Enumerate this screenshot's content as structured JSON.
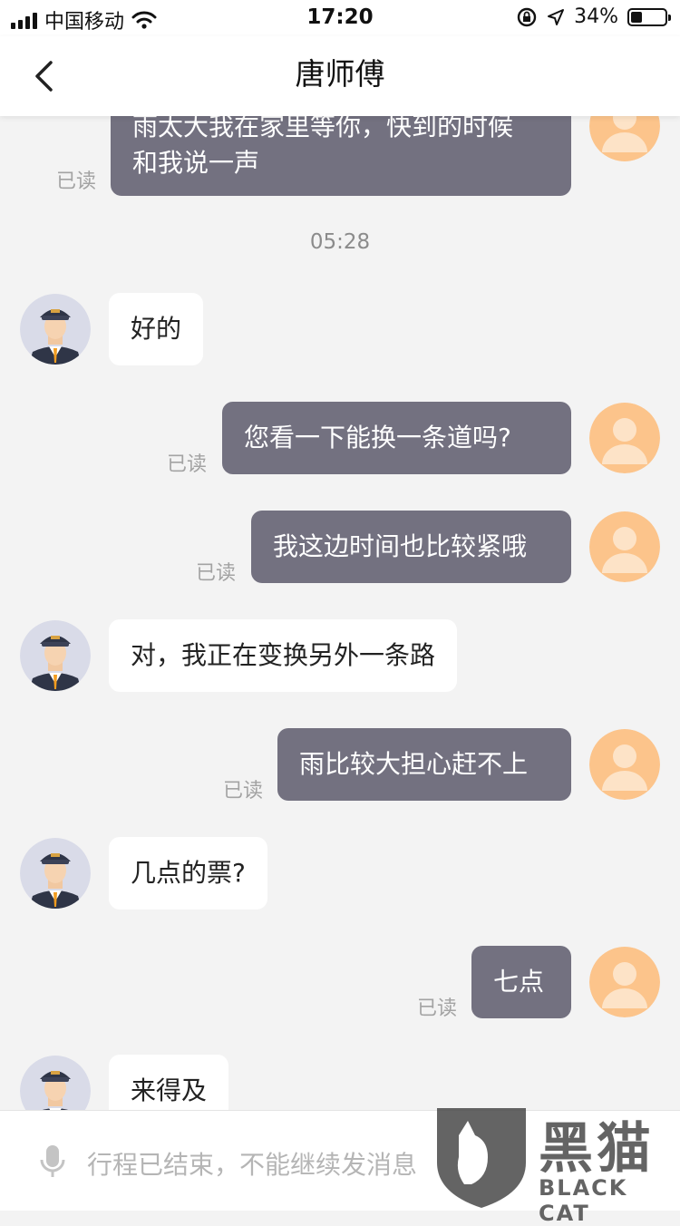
{
  "status_bar": {
    "carrier": "中国移动",
    "time": "17:20",
    "battery_percent_text": "34%",
    "battery_level": 0.34,
    "icons": [
      "signal-icon",
      "wifi-icon",
      "orientation-lock-icon",
      "location-arrow-icon",
      "battery-icon"
    ]
  },
  "header": {
    "title": "唐师傅",
    "back_icon": "chevron-left-icon"
  },
  "chat": {
    "read_label": "已读",
    "time_separator": "05:28",
    "messages": [
      {
        "from": "me",
        "lines": [
          "雨太大我在家里等你，快到的时候",
          "和我说一声"
        ],
        "read": true
      },
      {
        "from": "driver",
        "lines": [
          "好的"
        ]
      },
      {
        "from": "me",
        "lines": [
          "您看一下能换一条道吗?"
        ],
        "read": true
      },
      {
        "from": "me",
        "lines": [
          "我这边时间也比较紧哦"
        ],
        "read": true
      },
      {
        "from": "driver",
        "lines": [
          "对，我正在变换另外一条路"
        ]
      },
      {
        "from": "me",
        "lines": [
          "雨比较大担心赶不上"
        ],
        "read": true
      },
      {
        "from": "driver",
        "lines": [
          "几点的票?"
        ]
      },
      {
        "from": "me",
        "lines": [
          "七点"
        ],
        "read": true
      },
      {
        "from": "driver",
        "lines": [
          "来得及"
        ]
      }
    ]
  },
  "input_bar": {
    "mic_icon": "microphone-icon",
    "disabled_text": "行程已结束，不能继续发消息"
  },
  "watermark": {
    "text_cn": "黑猫",
    "text_en": "BLACK CAT"
  },
  "colors": {
    "my_bubble": "#737180",
    "driver_bubble": "#ffffff",
    "chat_background": "#f3f3f3",
    "user_avatar": "#fcc48b"
  }
}
